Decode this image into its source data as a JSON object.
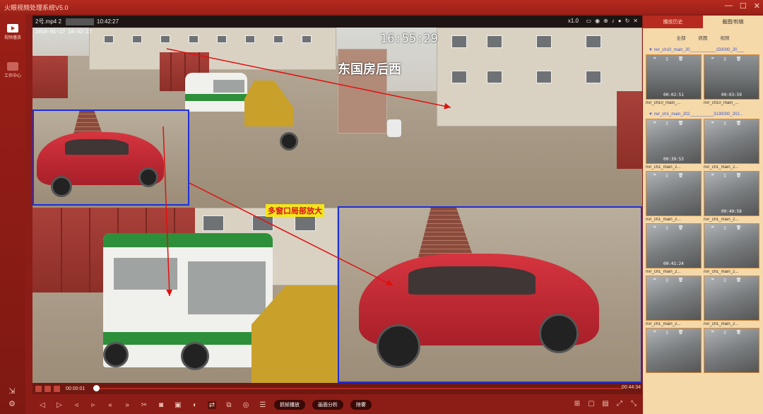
{
  "app": {
    "title": "火眼视频处理系统V5.0",
    "win_controls": [
      "—",
      "☐",
      "✕"
    ]
  },
  "leftnav": {
    "items": [
      {
        "label": "视频播放",
        "icon": "play-icon",
        "active": true
      },
      {
        "label": "工作中心",
        "icon": "briefcase-icon",
        "active": false
      }
    ],
    "bottom_icons": [
      "share-icon",
      "settings-icon"
    ]
  },
  "video": {
    "file_name": "2号.mp4  2",
    "clock": "10:42:27",
    "speed": "x1.0",
    "topbar_icons": [
      "display-icon",
      "snapshot-icon",
      "zoom-icon",
      "volume-icon",
      "record-icon",
      "rotate-icon",
      "close-icon"
    ],
    "small_timestamp": "2019-01-17 10:42:17",
    "timestamp": "16:55:29",
    "camera_label": "东国房后西",
    "zoom_label": "多窗口局部放大"
  },
  "timeline": {
    "current": "00:00:01",
    "end": "00:44:34",
    "progress": 0.001
  },
  "toolbar": {
    "icons": [
      "prev-frame-icon",
      "play-icon",
      "step-back-icon",
      "step-forward-icon",
      "rewind-icon",
      "fast-forward-icon",
      "cut-icon",
      "camera-icon",
      "snapshot-icon",
      "brightness-icon",
      "ab-loop-icon",
      "region-icon",
      "target-icon",
      "list-icon"
    ],
    "pills": [
      "抓帧播放",
      "画面分析",
      "除雾"
    ],
    "right_icons": [
      "grid-icon",
      "window-icon",
      "layout-icon",
      "fullscreen-icon",
      "exit-fullscreen-icon"
    ]
  },
  "right_panel": {
    "tabs": [
      {
        "label": "播放历史",
        "active": false
      },
      {
        "label": "截图/剪辑",
        "active": true
      }
    ],
    "subtabs": [
      "全部",
      "抓图",
      "视频"
    ],
    "groups": [
      {
        "title": "▼ nvr_ch10_main_20___________150000_20___",
        "thumbs": [
          {
            "name": "nvr_ch10_main_...",
            "duration": "00:02:51",
            "style": "dark"
          },
          {
            "name": "nvr_ch10_main_...",
            "duration": "00:03:59",
            "style": "dark"
          }
        ]
      },
      {
        "title": "▼ nvr_ch1_main_202__________3130000_202...",
        "thumbs": [
          {
            "name": "nvr_ch1_main_2...",
            "duration": "00:39:53",
            "style": "road"
          },
          {
            "name": "nvr_ch1_main_2...",
            "duration": "",
            "style": "road"
          },
          {
            "name": "nvr_ch1_main_2...",
            "duration": "",
            "style": "road"
          },
          {
            "name": "nvr_ch1_main_2...",
            "duration": "00:40:58",
            "style": "road"
          },
          {
            "name": "nvr_ch1_main_2...",
            "duration": "00:41:24",
            "style": "road"
          },
          {
            "name": "nvr_ch1_main_2...",
            "duration": "",
            "style": "road"
          },
          {
            "name": "nvr_ch1_main_2...",
            "duration": "",
            "style": "road"
          },
          {
            "name": "nvr_ch1_main_2...",
            "duration": "",
            "style": "road"
          },
          {
            "name": "",
            "duration": "",
            "style": "road"
          },
          {
            "name": "",
            "duration": "",
            "style": "road"
          }
        ]
      }
    ]
  },
  "colors": {
    "brand_red": "#b52a1f",
    "panel_beige": "#f6d9a9",
    "highlight_blue": "#1d2fd9",
    "arrow_red": "#e01010"
  }
}
